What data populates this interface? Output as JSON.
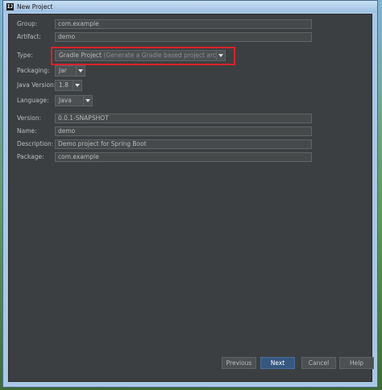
{
  "window": {
    "title": "New Project",
    "app_icon_text": "IJ"
  },
  "form": {
    "group": {
      "label": "Group:",
      "value": "com.example"
    },
    "artifact": {
      "label": "Artifact:",
      "value": "demo"
    },
    "type": {
      "label": "Type:",
      "value": "Gradle Project",
      "hint": "(Generate a Gradle based project archive)"
    },
    "packaging": {
      "label": "Packaging:",
      "value": "Jar"
    },
    "java_version": {
      "label": "Java Version:",
      "value": "1.8"
    },
    "language": {
      "label": "Language:",
      "value": "Java"
    },
    "version": {
      "label": "Version:",
      "value": "0.0.1-SNAPSHOT"
    },
    "name": {
      "label": "Name:",
      "value": "demo"
    },
    "description": {
      "label": "Description:",
      "value": "Demo project for Spring Boot"
    },
    "package": {
      "label": "Package:",
      "value": "com.example"
    }
  },
  "buttons": {
    "previous": "Previous",
    "next": "Next",
    "cancel": "Cancel",
    "help": "Help"
  },
  "colors": {
    "panel_bg": "#3c3f41",
    "highlight_border": "#d9232a",
    "primary_button": "#365880"
  }
}
